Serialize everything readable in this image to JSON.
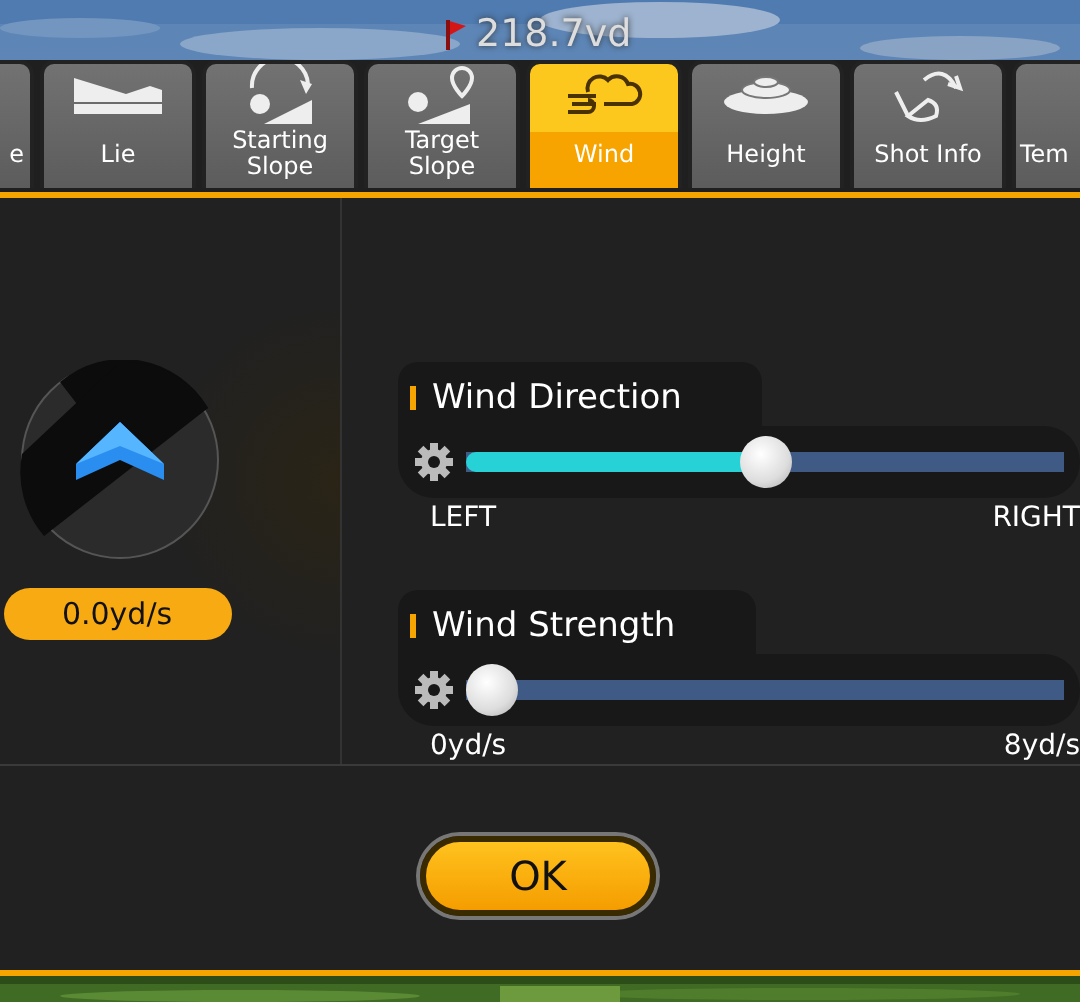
{
  "header": {
    "distance": "218.7vd"
  },
  "tabs": [
    {
      "label": "e",
      "selected": false
    },
    {
      "label": "Lie",
      "selected": false
    },
    {
      "label": "Starting Slope",
      "selected": false
    },
    {
      "label": "Target Slope",
      "selected": false
    },
    {
      "label": "Wind",
      "selected": true
    },
    {
      "label": "Height",
      "selected": false
    },
    {
      "label": "Shot Info",
      "selected": false
    },
    {
      "label": "Tem",
      "selected": false
    }
  ],
  "wind_indicator": {
    "speed": "0.0yd/s"
  },
  "sliders": [
    {
      "title": "Wind Direction",
      "level": 0.5,
      "min_label": "LEFT",
      "max_label": "RIGHT"
    },
    {
      "title": "Wind Strength",
      "level": 0,
      "min_label": "0yd/s",
      "max_label": "8yd/s"
    }
  ],
  "ok_button": "OK"
}
